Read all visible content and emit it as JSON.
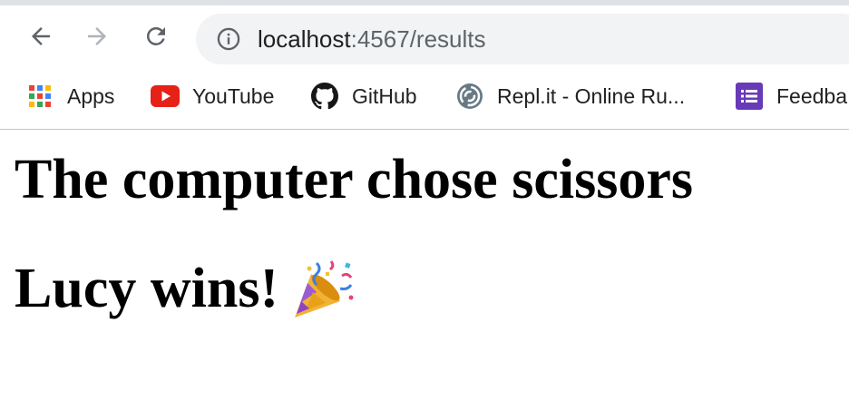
{
  "browser": {
    "url_host": "localhost",
    "url_rest": ":4567/results",
    "icons": {
      "back": "back-arrow-icon",
      "forward": "forward-arrow-icon",
      "reload": "reload-icon",
      "info": "info-icon"
    }
  },
  "bookmarks": [
    {
      "label": "Apps",
      "icon": "apps-grid-icon"
    },
    {
      "label": "YouTube",
      "icon": "youtube-icon"
    },
    {
      "label": "GitHub",
      "icon": "github-icon"
    },
    {
      "label": "Repl.it - Online Ru...",
      "icon": "replit-icon"
    },
    {
      "label": "Feedba",
      "icon": "forms-icon"
    }
  ],
  "page": {
    "choice_heading": "The computer chose scissors",
    "result_heading": "Lucy wins!",
    "result_emoji": "party-popper-icon"
  },
  "colors": {
    "tab_strip": "#dee1e6",
    "omnibox_bg": "#f1f3f4",
    "youtube_red": "#e62117",
    "forms_purple": "#673ab7"
  }
}
